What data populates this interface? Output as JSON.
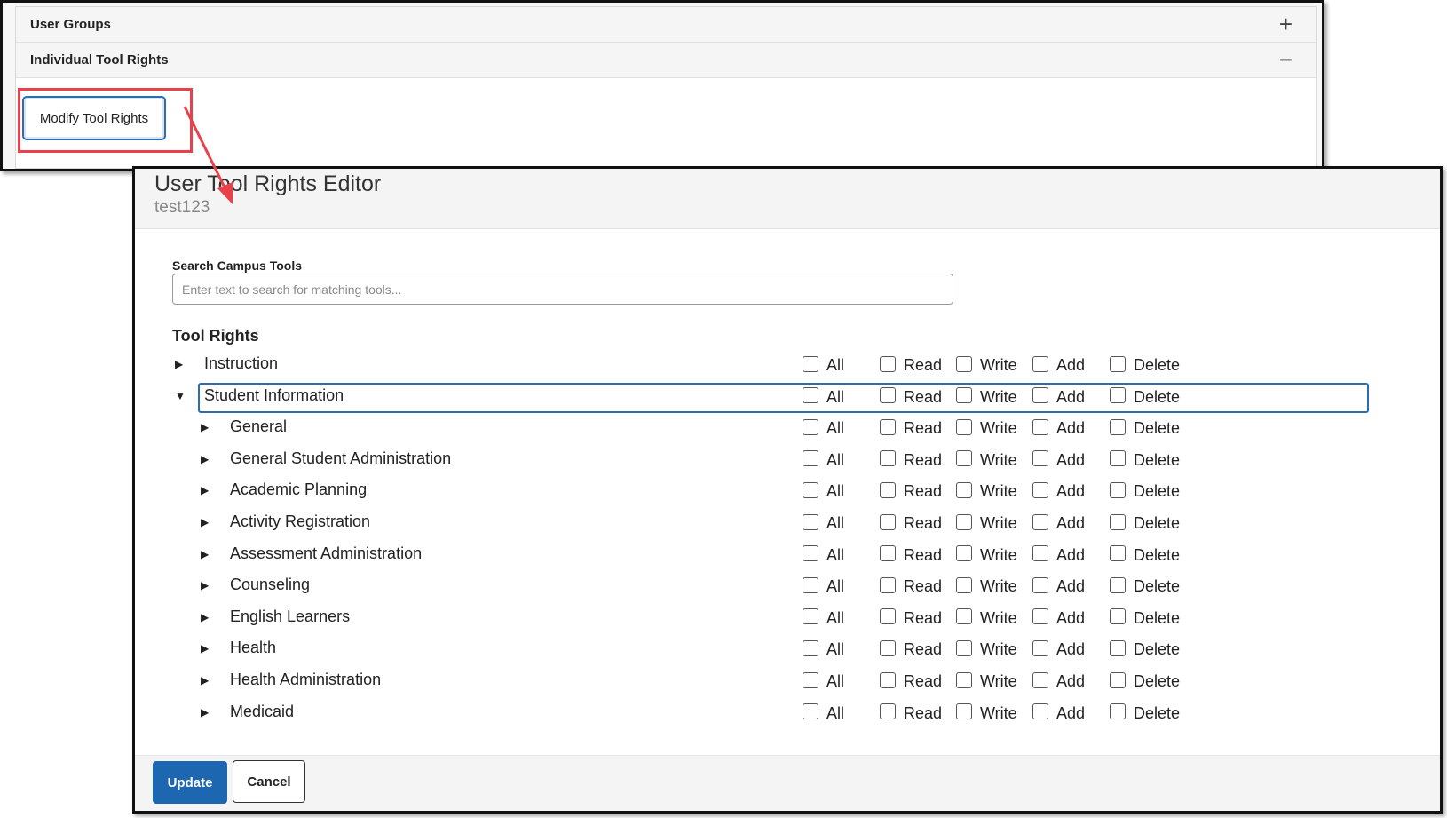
{
  "background": {
    "sections": [
      {
        "title": "User Groups",
        "toggle": "+"
      },
      {
        "title": "Individual Tool Rights",
        "toggle": "−"
      }
    ],
    "modify_button_label": "Modify Tool Rights"
  },
  "modal": {
    "title": "User Tool Rights Editor",
    "subtitle": "test123",
    "search": {
      "label": "Search Campus Tools",
      "placeholder": "Enter text to search for matching tools..."
    },
    "tool_rights_heading": "Tool Rights",
    "permission_columns": [
      "All",
      "Read",
      "Write",
      "Add",
      "Delete"
    ],
    "rows": [
      {
        "label": "Instruction",
        "expanded": false,
        "level": 0
      },
      {
        "label": "Student Information",
        "expanded": true,
        "level": 0,
        "selected": true
      },
      {
        "label": "General",
        "expanded": false,
        "level": 1
      },
      {
        "label": "General Student Administration",
        "expanded": false,
        "level": 1
      },
      {
        "label": "Academic Planning",
        "expanded": false,
        "level": 1
      },
      {
        "label": "Activity Registration",
        "expanded": false,
        "level": 1
      },
      {
        "label": "Assessment Administration",
        "expanded": false,
        "level": 1
      },
      {
        "label": "Counseling",
        "expanded": false,
        "level": 1
      },
      {
        "label": "English Learners",
        "expanded": false,
        "level": 1
      },
      {
        "label": "Health",
        "expanded": false,
        "level": 1
      },
      {
        "label": "Health Administration",
        "expanded": false,
        "level": 1
      },
      {
        "label": "Medicaid",
        "expanded": false,
        "level": 1
      }
    ],
    "footer": {
      "update_label": "Update",
      "cancel_label": "Cancel"
    }
  },
  "colors": {
    "accent": "#1c67b0",
    "annotation_red": "#e8414a"
  }
}
